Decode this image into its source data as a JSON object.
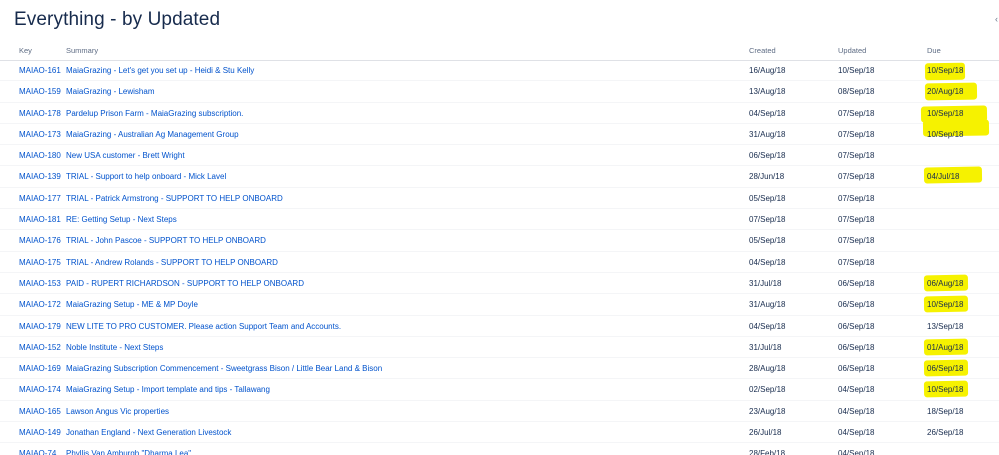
{
  "title": "Everything - by Updated",
  "columns": {
    "key": "Key",
    "summary": "Summary",
    "created": "Created",
    "updated": "Updated",
    "due": "Due"
  },
  "highlight_color": "#f6f200",
  "link_color": "#0052cc",
  "issues": [
    {
      "key": "MAIAO-161",
      "summary": "MaiaGrazing - Let's get you set up - Heidi & Stu Kelly",
      "created": "16/Aug/18",
      "updated": "10/Sep/18",
      "due": "10/Sep/18",
      "highlighted": true
    },
    {
      "key": "MAIAO-159",
      "summary": "MaiaGrazing - Lewisham",
      "created": "13/Aug/18",
      "updated": "08/Sep/18",
      "due": "20/Aug/18",
      "highlighted": true
    },
    {
      "key": "MAIAO-178",
      "summary": "Pardelup Prison Farm - MaiaGrazing subscription.",
      "created": "04/Sep/18",
      "updated": "07/Sep/18",
      "due": "10/Sep/18",
      "highlighted": true
    },
    {
      "key": "MAIAO-173",
      "summary": "MaiaGrazing - Australian Ag Management Group",
      "created": "31/Aug/18",
      "updated": "07/Sep/18",
      "due": "10/Sep/18",
      "highlighted": true
    },
    {
      "key": "MAIAO-180",
      "summary": "New USA customer - Brett Wright",
      "created": "06/Sep/18",
      "updated": "07/Sep/18",
      "due": "",
      "highlighted": false
    },
    {
      "key": "MAIAO-139",
      "summary": "TRIAL - Support to help onboard - Mick Lavel",
      "created": "28/Jun/18",
      "updated": "07/Sep/18",
      "due": "04/Jul/18",
      "highlighted": true
    },
    {
      "key": "MAIAO-177",
      "summary": "TRIAL - Patrick Armstrong - SUPPORT TO HELP ONBOARD",
      "created": "05/Sep/18",
      "updated": "07/Sep/18",
      "due": "",
      "highlighted": false
    },
    {
      "key": "MAIAO-181",
      "summary": "RE: Getting Setup - Next Steps",
      "created": "07/Sep/18",
      "updated": "07/Sep/18",
      "due": "",
      "highlighted": false
    },
    {
      "key": "MAIAO-176",
      "summary": "TRIAL - John Pascoe - SUPPORT TO HELP ONBOARD",
      "created": "05/Sep/18",
      "updated": "07/Sep/18",
      "due": "",
      "highlighted": false
    },
    {
      "key": "MAIAO-175",
      "summary": "TRIAL - Andrew Rolands - SUPPORT TO HELP ONBOARD",
      "created": "04/Sep/18",
      "updated": "07/Sep/18",
      "due": "",
      "highlighted": false
    },
    {
      "key": "MAIAO-153",
      "summary": "PAID - RUPERT RICHARDSON - SUPPORT TO HELP ONBOARD",
      "created": "31/Jul/18",
      "updated": "06/Sep/18",
      "due": "06/Aug/18",
      "highlighted": true
    },
    {
      "key": "MAIAO-172",
      "summary": "MaiaGrazing Setup - ME & MP Doyle",
      "created": "31/Aug/18",
      "updated": "06/Sep/18",
      "due": "10/Sep/18",
      "highlighted": true
    },
    {
      "key": "MAIAO-179",
      "summary": "NEW LITE TO PRO CUSTOMER. Please action Support Team and Accounts.",
      "created": "04/Sep/18",
      "updated": "06/Sep/18",
      "due": "13/Sep/18",
      "highlighted": false
    },
    {
      "key": "MAIAO-152",
      "summary": "Noble Institute - Next Steps",
      "created": "31/Jul/18",
      "updated": "06/Sep/18",
      "due": "01/Aug/18",
      "highlighted": true
    },
    {
      "key": "MAIAO-169",
      "summary": "MaiaGrazing Subscription Commencement - Sweetgrass Bison / Little Bear Land & Bison",
      "created": "28/Aug/18",
      "updated": "06/Sep/18",
      "due": "06/Sep/18",
      "highlighted": true
    },
    {
      "key": "MAIAO-174",
      "summary": "MaiaGrazing Setup - Import template and tips - Tallawang",
      "created": "02/Sep/18",
      "updated": "04/Sep/18",
      "due": "10/Sep/18",
      "highlighted": true
    },
    {
      "key": "MAIAO-165",
      "summary": "Lawson Angus Vic properties",
      "created": "23/Aug/18",
      "updated": "04/Sep/18",
      "due": "18/Sep/18",
      "highlighted": false
    },
    {
      "key": "MAIAO-149",
      "summary": "Jonathan England - Next Generation Livestock",
      "created": "26/Jul/18",
      "updated": "04/Sep/18",
      "due": "26/Sep/18",
      "highlighted": false
    },
    {
      "key": "MAIAO-74",
      "summary": "Phyllis Van Amburgh \"Dharma Lea\"",
      "created": "28/Feb/18",
      "updated": "04/Sep/18",
      "due": "",
      "highlighted": false
    }
  ]
}
